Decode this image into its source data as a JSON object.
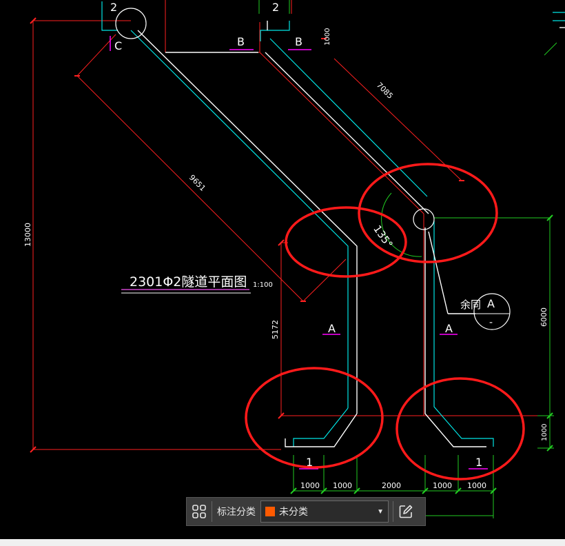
{
  "drawing": {
    "title": "2301Φ2隧道平面图",
    "scale": "1:100",
    "angle": "135°",
    "note_text": "余同",
    "section_callout": {
      "top": "A",
      "bottom": "-"
    },
    "grid_labels": {
      "a": "2",
      "b": "2",
      "c": "C"
    },
    "section_marks": {
      "b1": "B",
      "b2": "B",
      "a1": "A",
      "a2": "A",
      "s1": "1",
      "s2": "1"
    },
    "dimensions": {
      "d1000_top": "1000",
      "d7085": "7085",
      "d9651": "9651",
      "d13000": "13000",
      "d5172": "5172",
      "d6000": "6000",
      "d1000_right": "1000",
      "bottom": [
        "1000",
        "1000",
        "2000",
        "1000",
        "1000"
      ]
    },
    "colors": {
      "background": "#000000",
      "dimension": "#ff2020",
      "outline_cyan": "#00e5e5",
      "outline_white": "#ffffff",
      "dimension_green": "#22cc22",
      "section_mark": "#ff00ff",
      "highlight": "#ff1a1a",
      "title_line": "#cc44cc"
    }
  },
  "toolbar": {
    "grid_icon": "grid-icon",
    "label": "标注分类",
    "select_value": "未分类",
    "swatch_color": "#ff5a00",
    "dropdown_icon": "chevron-down-icon",
    "edit_icon": "edit-icon"
  }
}
